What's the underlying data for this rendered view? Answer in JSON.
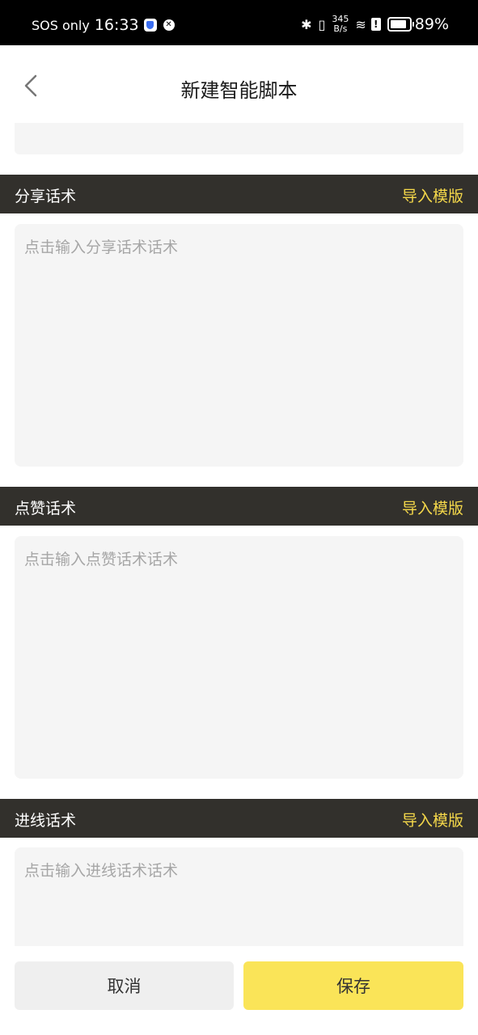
{
  "status_bar": {
    "carrier": "SOS only",
    "time": "16:33",
    "net_speed_value": "345",
    "net_speed_unit": "B/s",
    "battery": "89%"
  },
  "header": {
    "title": "新建智能脚本"
  },
  "sections": [
    {
      "title": "分享话术",
      "import_label": "导入模版",
      "placeholder": "点击输入分享话术话术"
    },
    {
      "title": "点赞话术",
      "import_label": "导入模版",
      "placeholder": "点击输入点赞话术话术"
    },
    {
      "title": "进线话术",
      "import_label": "导入模版",
      "placeholder": "点击输入进线话术话术"
    }
  ],
  "footer": {
    "cancel_label": "取消",
    "save_label": "保存"
  },
  "colors": {
    "section_bar": "#32302c",
    "accent_text": "#f5d84a",
    "save_button": "#fae458"
  }
}
